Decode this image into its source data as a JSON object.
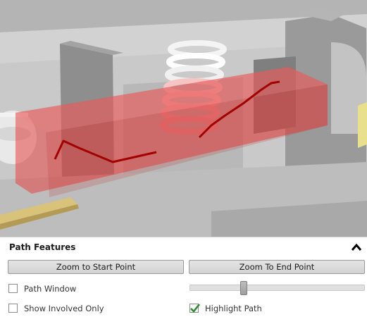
{
  "panel": {
    "title": "Path Features",
    "collapse_icon": "chevron-up-icon",
    "zoom_start_label": "Zoom to Start Point",
    "zoom_end_label": "Zoom To End Point",
    "path_window": {
      "label": "Path Window",
      "checked": false
    },
    "show_involved": {
      "label": "Show Involved Only",
      "checked": false
    },
    "highlight_path": {
      "label": "Highlight Path",
      "checked": true,
      "check_color": "#2e8b2e"
    },
    "slider_level": 0.3
  },
  "viewport": {
    "path_color": "#a30000",
    "highlight_color": "#e64545"
  }
}
